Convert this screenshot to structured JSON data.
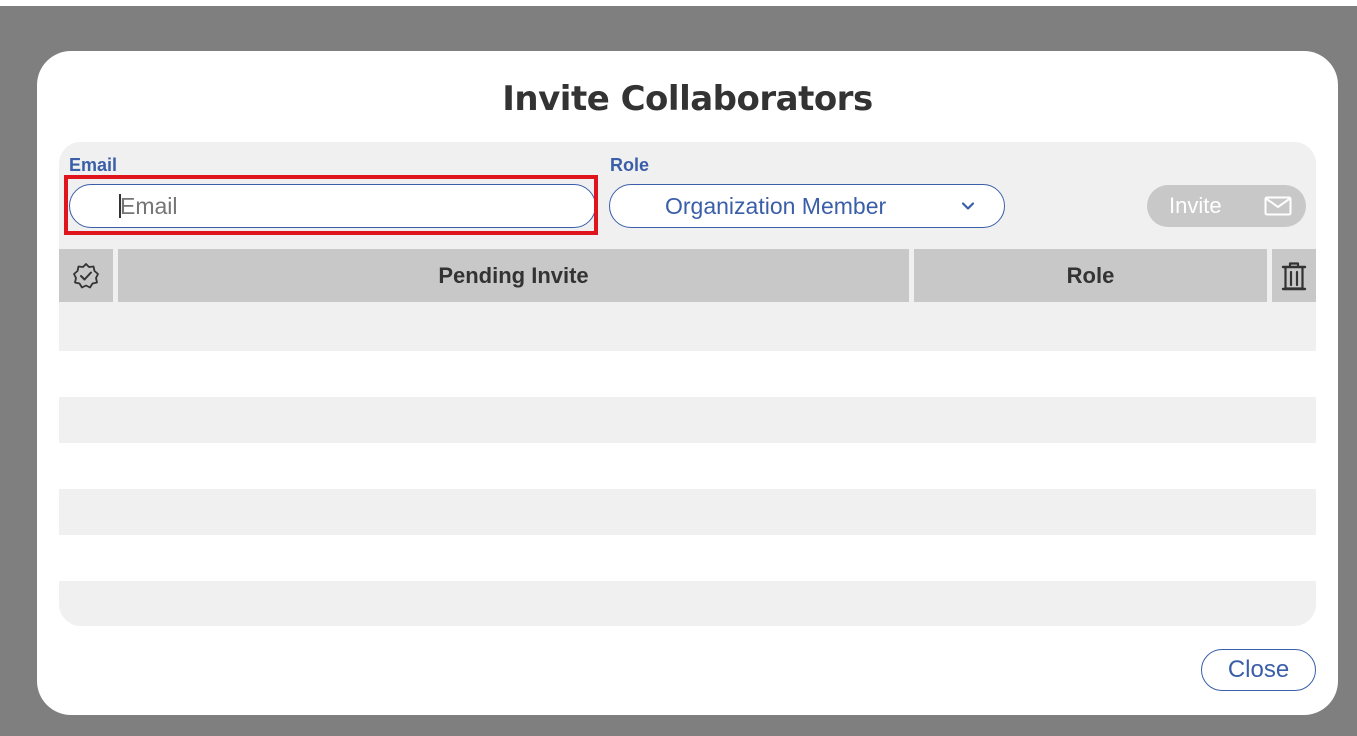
{
  "modal": {
    "title": "Invite Collaborators"
  },
  "form": {
    "email_label": "Email",
    "email_placeholder": "Email",
    "email_value": "",
    "role_label": "Role",
    "role_selected": "Organization Member",
    "invite_label": "Invite"
  },
  "table": {
    "columns": {
      "pending": "Pending Invite",
      "role": "Role"
    },
    "rows": []
  },
  "footer": {
    "close_label": "Close"
  },
  "colors": {
    "accent": "#3a5ea8",
    "highlight": "#e0141c",
    "header_bg": "#c8c8c8",
    "backdrop": "#7f7f7f"
  },
  "icons": {
    "select_all": "badge-check-icon",
    "delete": "trash-icon",
    "invite": "envelope-icon",
    "role_dropdown": "chevron-down-icon"
  }
}
